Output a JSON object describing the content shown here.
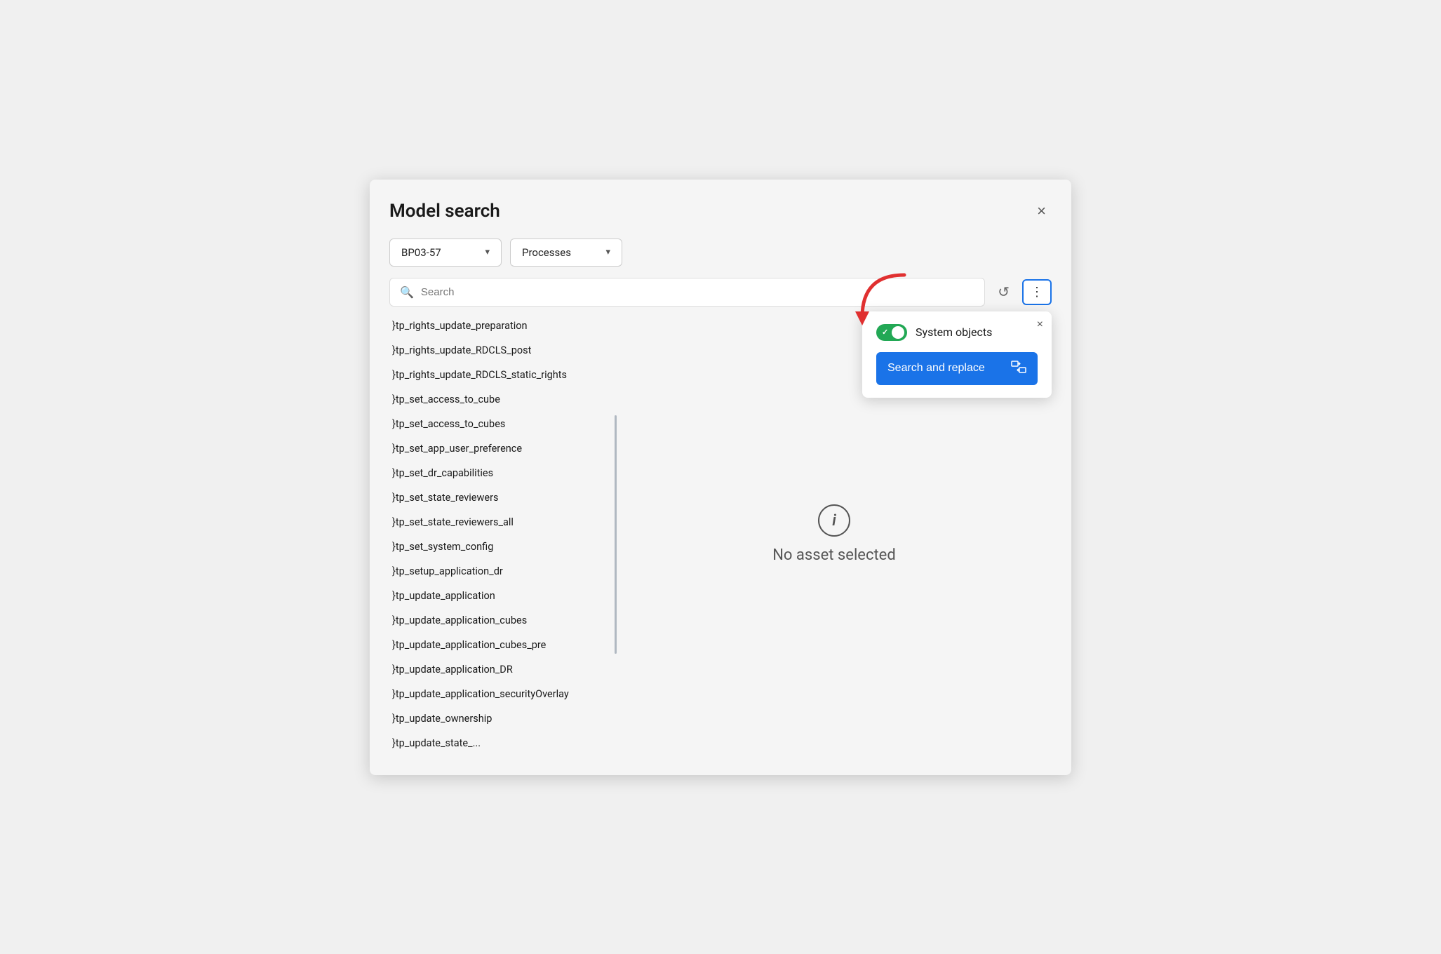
{
  "modal": {
    "title": "Model search",
    "close_label": "×"
  },
  "dropdowns": {
    "project": {
      "value": "BP03-57",
      "options": [
        "BP03-57"
      ]
    },
    "category": {
      "value": "Processes",
      "options": [
        "Processes"
      ]
    }
  },
  "search": {
    "placeholder": "Search",
    "value": ""
  },
  "toolbar": {
    "refresh_label": "↺",
    "more_label": "⋮"
  },
  "popup": {
    "close_label": "×",
    "system_objects_label": "System objects",
    "toggle_enabled": true,
    "search_replace_label": "Search and replace"
  },
  "list": {
    "items": [
      "}tp_rights_update_preparation",
      "}tp_rights_update_RDCLS_post",
      "}tp_rights_update_RDCLS_static_rights",
      "}tp_set_access_to_cube",
      "}tp_set_access_to_cubes",
      "}tp_set_app_user_preference",
      "}tp_set_dr_capabilities",
      "}tp_set_state_reviewers",
      "}tp_set_state_reviewers_all",
      "}tp_set_system_config",
      "}tp_setup_application_dr",
      "}tp_update_application",
      "}tp_update_application_cubes",
      "}tp_update_application_cubes_pre",
      "}tp_update_application_DR",
      "}tp_update_application_securityOverlay",
      "}tp_update_ownership",
      "}tp_update_state_..."
    ]
  },
  "right_panel": {
    "no_asset_label": "No asset selected"
  }
}
